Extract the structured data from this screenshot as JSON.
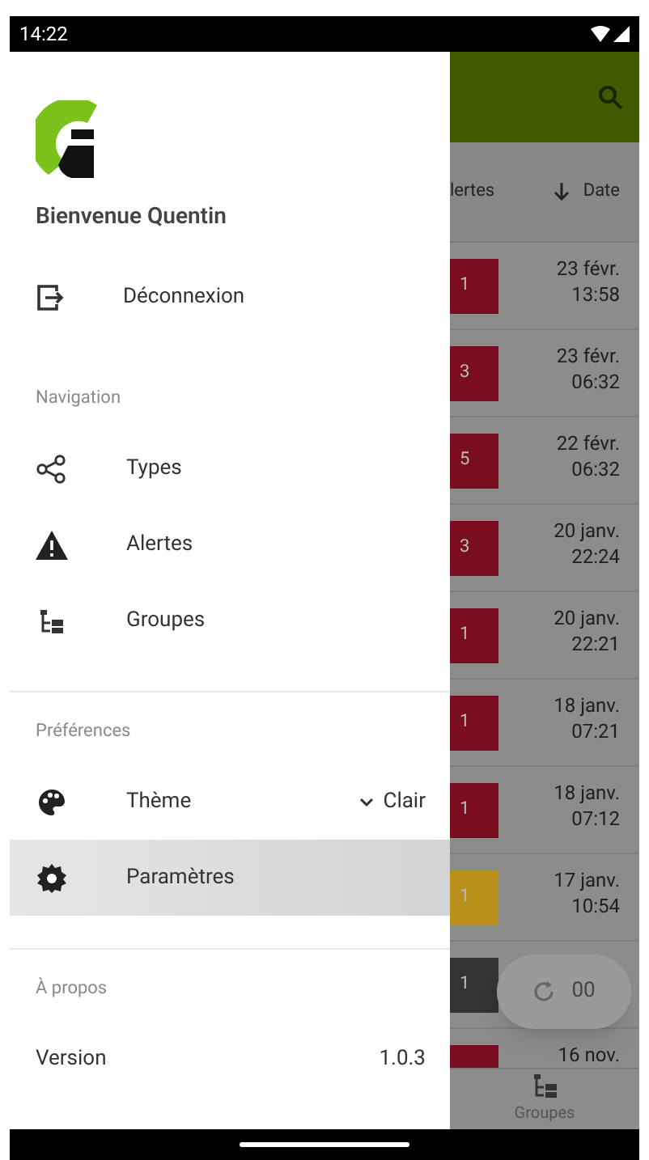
{
  "status_bar": {
    "time": "14:22"
  },
  "drawer": {
    "greeting": "Bienvenue Quentin",
    "account_item": {
      "label": "Déconnexion"
    },
    "sections": [
      {
        "header": "Navigation",
        "items": [
          {
            "kind": "link",
            "label": "Types",
            "selected": false
          },
          {
            "kind": "link",
            "label": "Alertes",
            "selected": false
          },
          {
            "kind": "link",
            "label": "Groupes",
            "selected": false
          }
        ]
      },
      {
        "header": "Préférences",
        "items": [
          {
            "kind": "dropdown",
            "label": "Thème",
            "value": "Clair",
            "selected": false
          },
          {
            "kind": "link",
            "label": "Paramètres",
            "selected": true
          }
        ]
      },
      {
        "header": "À propos",
        "items": [
          {
            "kind": "info",
            "label": "Version",
            "value": "1.0.3"
          }
        ]
      }
    ]
  },
  "alerts_list": {
    "columns": [
      "lertes",
      "Date"
    ],
    "rows": [
      {
        "count": "1",
        "color": "#7a0d20",
        "date": "23 févr.",
        "time": "13:58"
      },
      {
        "count": "3",
        "color": "#7a0d20",
        "date": "23 févr.",
        "time": "06:32"
      },
      {
        "count": "5",
        "color": "#7a0d20",
        "date": "22 févr.",
        "time": "06:32"
      },
      {
        "count": "3",
        "color": "#7a0d20",
        "date": "20 janv.",
        "time": "22:24"
      },
      {
        "count": "1",
        "color": "#7a0d20",
        "date": "20 janv.",
        "time": "22:21"
      },
      {
        "count": "1",
        "color": "#7a0d20",
        "date": "18 janv.",
        "time": "07:21"
      },
      {
        "count": "1",
        "color": "#7a0d20",
        "date": "18 janv.",
        "time": "07:12"
      },
      {
        "count": "1",
        "color": "#b8901a",
        "date": "17 janv.",
        "time": "10:54"
      },
      {
        "count": "1",
        "color": "#333333"
      },
      {
        "color": "#7a0d20",
        "date": "16 nov."
      }
    ]
  },
  "refresh_button": {
    "label": "00"
  },
  "bottom_nav": {
    "items": [
      {
        "label": "Groupes"
      }
    ]
  }
}
